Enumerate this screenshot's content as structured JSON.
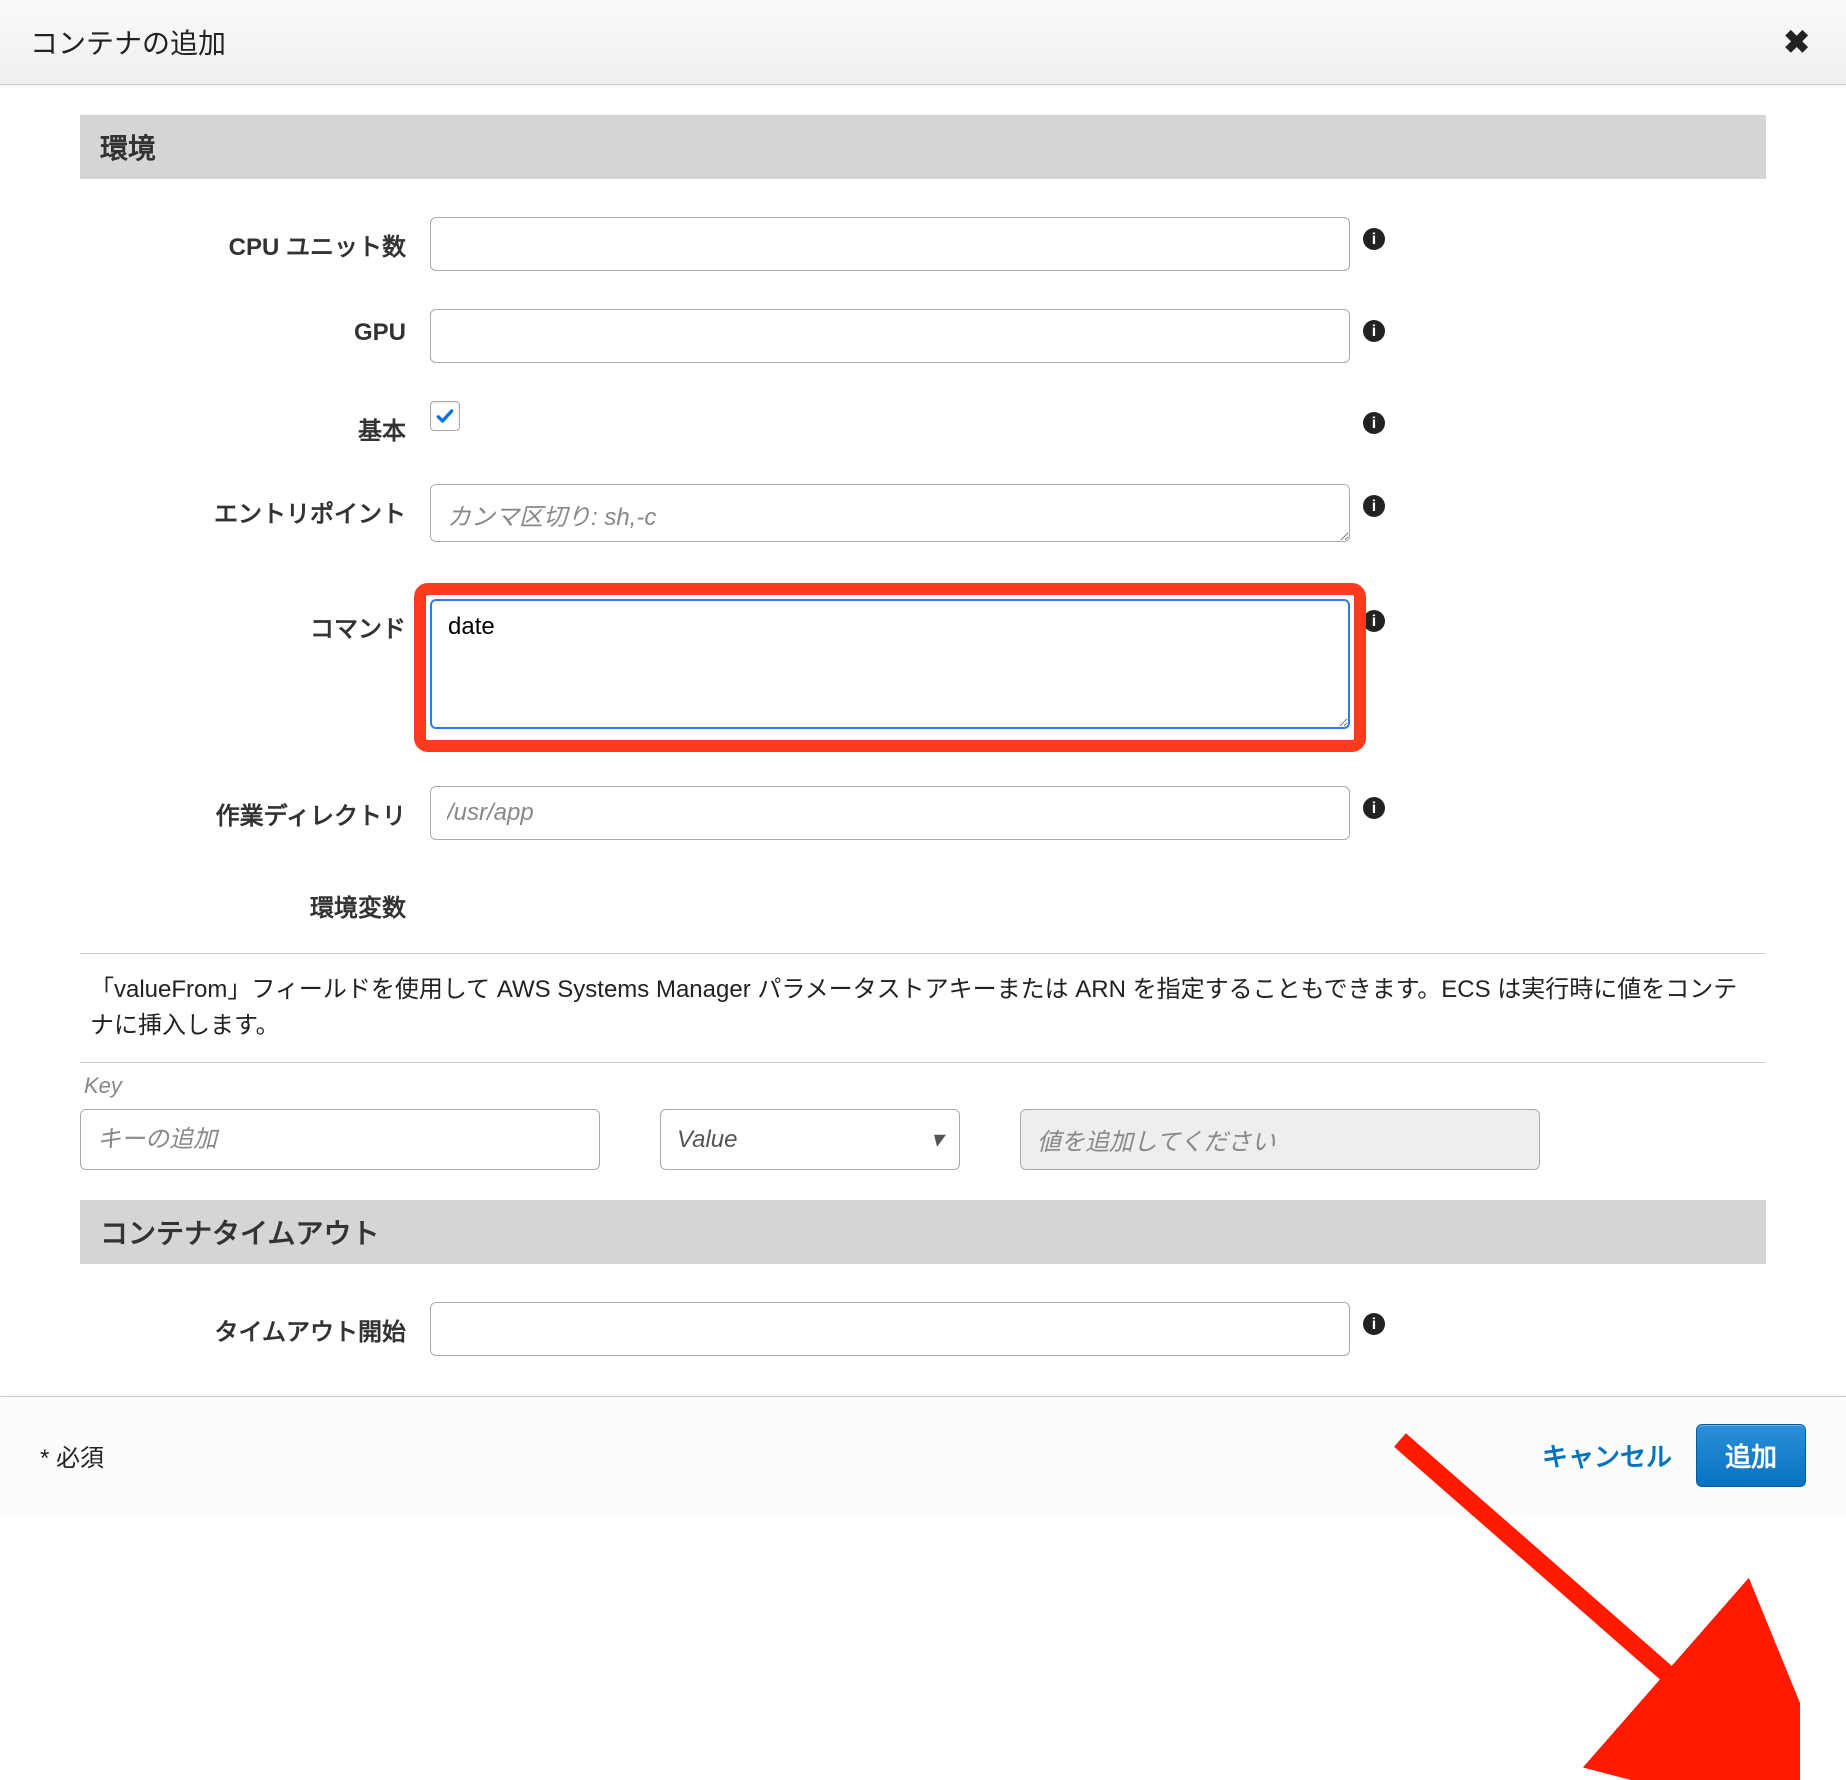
{
  "modal": {
    "title": "コンテナの追加"
  },
  "sections": {
    "env_header": "環境",
    "timeout_header": "コンテナタイムアウト"
  },
  "fields": {
    "cpu_label": "CPU ユニット数",
    "cpu_value": "",
    "gpu_label": "GPU",
    "gpu_value": "",
    "essential_label": "基本",
    "essential_checked": true,
    "entrypoint_label": "エントリポイント",
    "entrypoint_placeholder": "カンマ区切り: sh,-c",
    "entrypoint_value": "",
    "command_label": "コマンド",
    "command_value": "date",
    "workdir_label": "作業ディレクトリ",
    "workdir_placeholder": "/usr/app",
    "workdir_value": "",
    "envvar_label": "環境変数",
    "start_timeout_label": "タイムアウト開始",
    "start_timeout_value": ""
  },
  "env_note": "「valueFrom」フィールドを使用して AWS Systems Manager パラメータストアキーまたは ARN を指定することもできます。ECS は実行時に値をコンテナに挿入します。",
  "env_table": {
    "key_header": "Key",
    "key_placeholder": "キーの追加",
    "type_selected": "Value",
    "value_placeholder": "値を追加してください"
  },
  "footer": {
    "required_note": "* 必須",
    "cancel": "キャンセル",
    "submit": "追加"
  }
}
